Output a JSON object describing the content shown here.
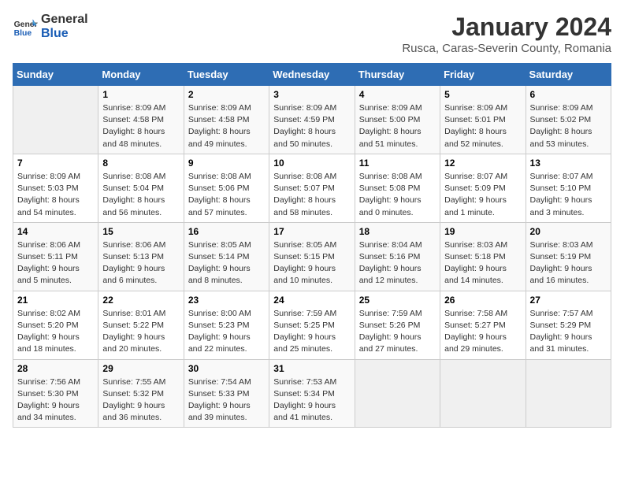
{
  "header": {
    "logo_general": "General",
    "logo_blue": "Blue",
    "month_title": "January 2024",
    "location": "Rusca, Caras-Severin County, Romania"
  },
  "days_of_week": [
    "Sunday",
    "Monday",
    "Tuesday",
    "Wednesday",
    "Thursday",
    "Friday",
    "Saturday"
  ],
  "weeks": [
    [
      {
        "day": "",
        "info": ""
      },
      {
        "day": "1",
        "info": "Sunrise: 8:09 AM\nSunset: 4:58 PM\nDaylight: 8 hours\nand 48 minutes."
      },
      {
        "day": "2",
        "info": "Sunrise: 8:09 AM\nSunset: 4:58 PM\nDaylight: 8 hours\nand 49 minutes."
      },
      {
        "day": "3",
        "info": "Sunrise: 8:09 AM\nSunset: 4:59 PM\nDaylight: 8 hours\nand 50 minutes."
      },
      {
        "day": "4",
        "info": "Sunrise: 8:09 AM\nSunset: 5:00 PM\nDaylight: 8 hours\nand 51 minutes."
      },
      {
        "day": "5",
        "info": "Sunrise: 8:09 AM\nSunset: 5:01 PM\nDaylight: 8 hours\nand 52 minutes."
      },
      {
        "day": "6",
        "info": "Sunrise: 8:09 AM\nSunset: 5:02 PM\nDaylight: 8 hours\nand 53 minutes."
      }
    ],
    [
      {
        "day": "7",
        "info": "Sunrise: 8:09 AM\nSunset: 5:03 PM\nDaylight: 8 hours\nand 54 minutes."
      },
      {
        "day": "8",
        "info": "Sunrise: 8:08 AM\nSunset: 5:04 PM\nDaylight: 8 hours\nand 56 minutes."
      },
      {
        "day": "9",
        "info": "Sunrise: 8:08 AM\nSunset: 5:06 PM\nDaylight: 8 hours\nand 57 minutes."
      },
      {
        "day": "10",
        "info": "Sunrise: 8:08 AM\nSunset: 5:07 PM\nDaylight: 8 hours\nand 58 minutes."
      },
      {
        "day": "11",
        "info": "Sunrise: 8:08 AM\nSunset: 5:08 PM\nDaylight: 9 hours\nand 0 minutes."
      },
      {
        "day": "12",
        "info": "Sunrise: 8:07 AM\nSunset: 5:09 PM\nDaylight: 9 hours\nand 1 minute."
      },
      {
        "day": "13",
        "info": "Sunrise: 8:07 AM\nSunset: 5:10 PM\nDaylight: 9 hours\nand 3 minutes."
      }
    ],
    [
      {
        "day": "14",
        "info": "Sunrise: 8:06 AM\nSunset: 5:11 PM\nDaylight: 9 hours\nand 5 minutes."
      },
      {
        "day": "15",
        "info": "Sunrise: 8:06 AM\nSunset: 5:13 PM\nDaylight: 9 hours\nand 6 minutes."
      },
      {
        "day": "16",
        "info": "Sunrise: 8:05 AM\nSunset: 5:14 PM\nDaylight: 9 hours\nand 8 minutes."
      },
      {
        "day": "17",
        "info": "Sunrise: 8:05 AM\nSunset: 5:15 PM\nDaylight: 9 hours\nand 10 minutes."
      },
      {
        "day": "18",
        "info": "Sunrise: 8:04 AM\nSunset: 5:16 PM\nDaylight: 9 hours\nand 12 minutes."
      },
      {
        "day": "19",
        "info": "Sunrise: 8:03 AM\nSunset: 5:18 PM\nDaylight: 9 hours\nand 14 minutes."
      },
      {
        "day": "20",
        "info": "Sunrise: 8:03 AM\nSunset: 5:19 PM\nDaylight: 9 hours\nand 16 minutes."
      }
    ],
    [
      {
        "day": "21",
        "info": "Sunrise: 8:02 AM\nSunset: 5:20 PM\nDaylight: 9 hours\nand 18 minutes."
      },
      {
        "day": "22",
        "info": "Sunrise: 8:01 AM\nSunset: 5:22 PM\nDaylight: 9 hours\nand 20 minutes."
      },
      {
        "day": "23",
        "info": "Sunrise: 8:00 AM\nSunset: 5:23 PM\nDaylight: 9 hours\nand 22 minutes."
      },
      {
        "day": "24",
        "info": "Sunrise: 7:59 AM\nSunset: 5:25 PM\nDaylight: 9 hours\nand 25 minutes."
      },
      {
        "day": "25",
        "info": "Sunrise: 7:59 AM\nSunset: 5:26 PM\nDaylight: 9 hours\nand 27 minutes."
      },
      {
        "day": "26",
        "info": "Sunrise: 7:58 AM\nSunset: 5:27 PM\nDaylight: 9 hours\nand 29 minutes."
      },
      {
        "day": "27",
        "info": "Sunrise: 7:57 AM\nSunset: 5:29 PM\nDaylight: 9 hours\nand 31 minutes."
      }
    ],
    [
      {
        "day": "28",
        "info": "Sunrise: 7:56 AM\nSunset: 5:30 PM\nDaylight: 9 hours\nand 34 minutes."
      },
      {
        "day": "29",
        "info": "Sunrise: 7:55 AM\nSunset: 5:32 PM\nDaylight: 9 hours\nand 36 minutes."
      },
      {
        "day": "30",
        "info": "Sunrise: 7:54 AM\nSunset: 5:33 PM\nDaylight: 9 hours\nand 39 minutes."
      },
      {
        "day": "31",
        "info": "Sunrise: 7:53 AM\nSunset: 5:34 PM\nDaylight: 9 hours\nand 41 minutes."
      },
      {
        "day": "",
        "info": ""
      },
      {
        "day": "",
        "info": ""
      },
      {
        "day": "",
        "info": ""
      }
    ]
  ]
}
